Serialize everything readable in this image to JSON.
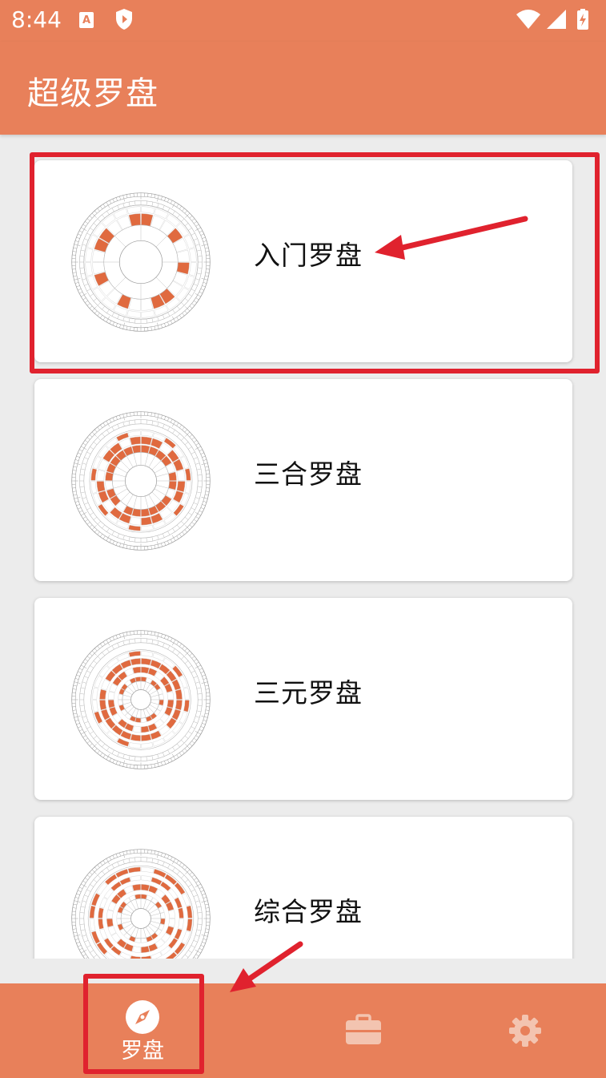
{
  "status_bar": {
    "time": "8:44"
  },
  "app_bar": {
    "title": "超级罗盘"
  },
  "colors": {
    "primary": "#e8805a",
    "compass_accent": "#e06a3f",
    "annotation_red": "#e0222e",
    "background": "#ececec",
    "card": "#ffffff"
  },
  "cards": [
    {
      "label": "入门罗盘",
      "icon": "compass-beginner-icon"
    },
    {
      "label": "三合罗盘",
      "icon": "compass-sanhe-icon"
    },
    {
      "label": "三元罗盘",
      "icon": "compass-sanyuan-icon"
    },
    {
      "label": "综合罗盘",
      "icon": "compass-comprehensive-icon"
    }
  ],
  "bottom_nav": {
    "items": [
      {
        "label": "罗盘",
        "icon": "compass-icon",
        "selected": true
      },
      {
        "label": "",
        "icon": "toolbox-icon",
        "selected": false
      },
      {
        "label": "",
        "icon": "gear-icon",
        "selected": false
      }
    ]
  }
}
